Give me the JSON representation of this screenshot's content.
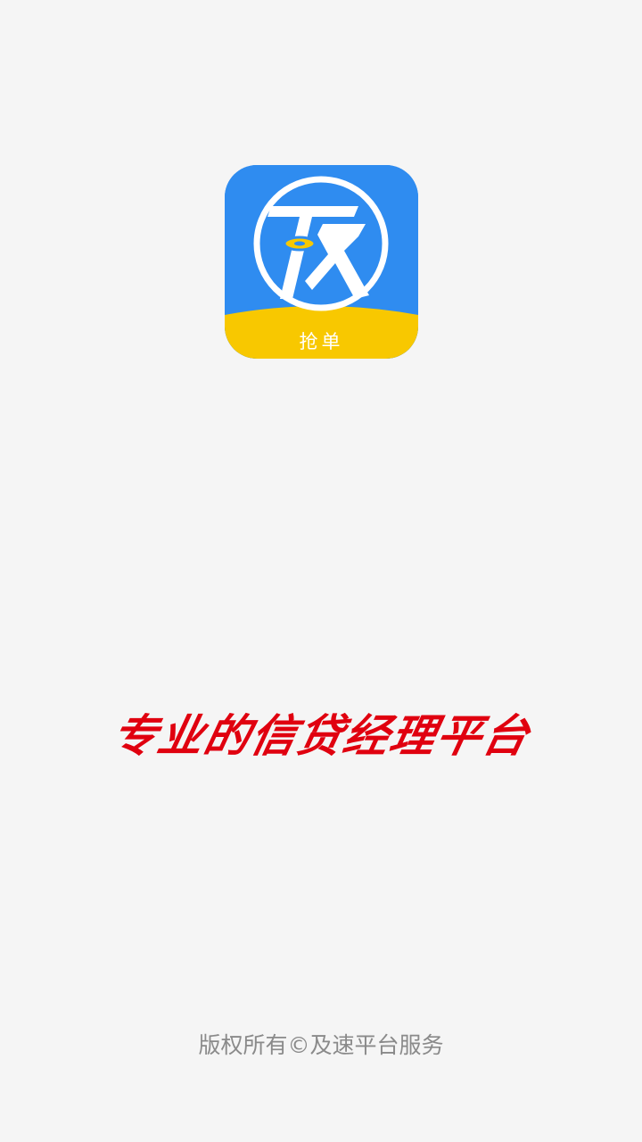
{
  "app_icon": {
    "badge_label": "抢单",
    "glyph": "及",
    "colors": {
      "primary": "#2f8cf0",
      "band": "#f8c800",
      "glyph": "#ffffff"
    }
  },
  "slogan": "专业的信贷经理平台",
  "footer": {
    "copyright": "版权所有©及速平台服务"
  },
  "colors": {
    "background": "#f5f5f5",
    "slogan": "#e0000f",
    "footer_text": "#8a8a8a"
  }
}
